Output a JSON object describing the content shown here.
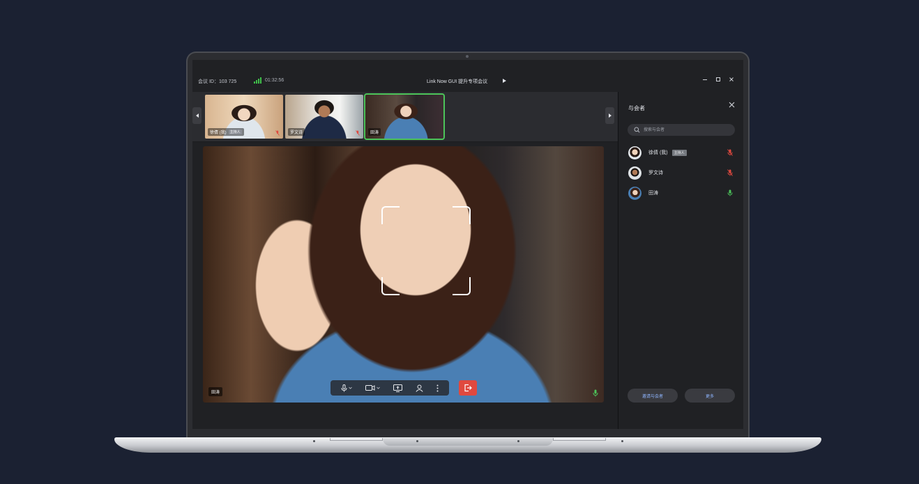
{
  "titlebar": {
    "meeting_id": "会议 ID：103 725",
    "duration": "01:32:56",
    "title": "Link Now GUI 提升专项会议",
    "icons": [
      "signal-icon",
      "play-icon",
      "minimize-icon",
      "maximize-icon",
      "close-icon"
    ]
  },
  "thumbnails": [
    {
      "name": "徐倩 (我)",
      "tag": "主持人",
      "muted": true,
      "active": false
    },
    {
      "name": "罗文诗",
      "tag": "",
      "muted": true,
      "active": false
    },
    {
      "name": "田涛",
      "tag": "",
      "muted": false,
      "active": true
    }
  ],
  "main_video": {
    "speaker_name": "田涛",
    "controls": [
      "microphone-icon",
      "camera-icon",
      "screen-share-icon",
      "participants-icon",
      "more-icon",
      "leave-icon"
    ]
  },
  "panel": {
    "title": "与会者",
    "search_placeholder": "搜索与会者",
    "participants": [
      {
        "name": "徐倩 (我)",
        "tag": "主持人",
        "mic": "muted"
      },
      {
        "name": "罗文诗",
        "tag": "",
        "mic": "muted"
      },
      {
        "name": "田涛",
        "tag": "",
        "mic": "active"
      }
    ],
    "invite_label": "邀请与会者",
    "more_label": "更多"
  },
  "colors": {
    "background": "#1b2132",
    "active_green": "#4cc45a",
    "muted_red": "#e0493f",
    "link_blue": "#8fb6ff"
  }
}
